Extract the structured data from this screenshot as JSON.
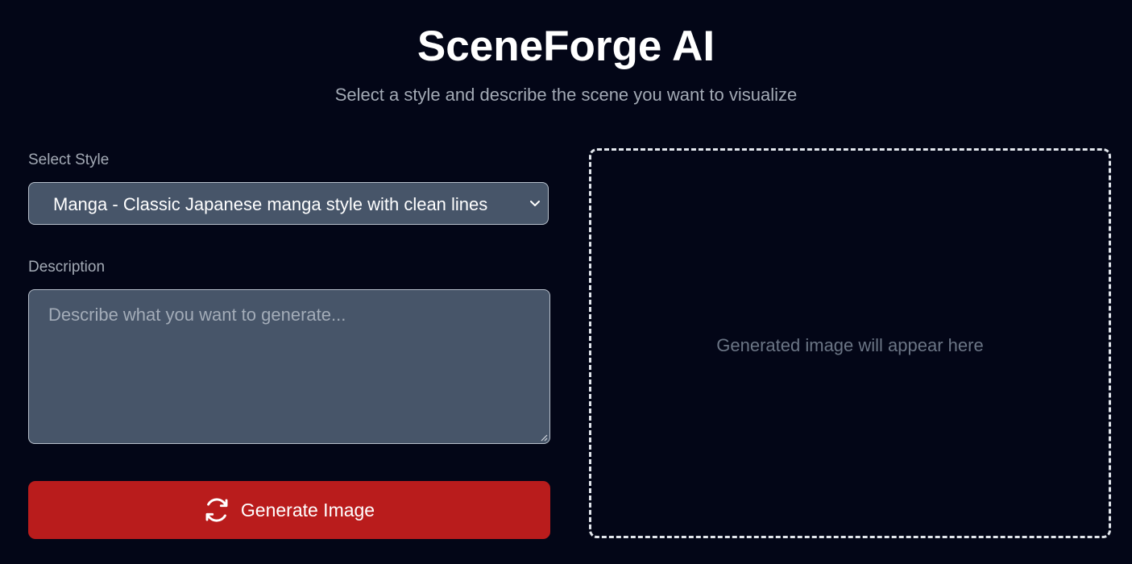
{
  "header": {
    "title": "SceneForge AI",
    "subtitle": "Select a style and describe the scene you want to visualize"
  },
  "form": {
    "style_label": "Select Style",
    "style_select": {
      "selected": "Manga - Classic Japanese manga style with clean lines",
      "icon": "chevron-down-icon"
    },
    "description_label": "Description",
    "description_input": {
      "value": "",
      "placeholder": "Describe what you want to generate..."
    },
    "generate_button": {
      "label": "Generate Image",
      "icon": "refresh-icon",
      "color": "#b91c1c"
    }
  },
  "preview": {
    "placeholder": "Generated image will appear here"
  },
  "colors": {
    "background": "#030617",
    "input_background": "#475569",
    "accent": "#b91c1c"
  }
}
